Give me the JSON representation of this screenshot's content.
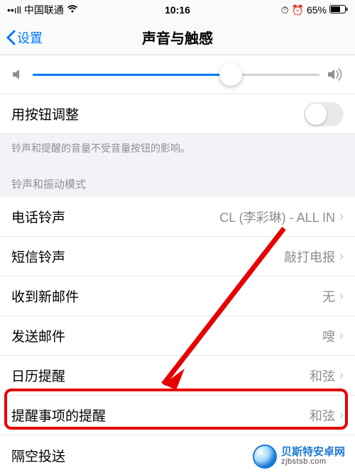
{
  "status_bar": {
    "signal_text": "••ıll",
    "carrier": "中国联通",
    "wifi_glyph": "",
    "time": "10:16",
    "alarm_glyph": "⏱",
    "clock_glyph": "⏰",
    "battery_pct": "65%",
    "battery_glyph": "▮▯"
  },
  "nav": {
    "back_label": "设置",
    "title": "声音与触感"
  },
  "slider": {
    "value_pct": 69
  },
  "button_adjust": {
    "label": "用按钮调整",
    "enabled": false
  },
  "footer_note": "铃声和提醒的音量不受音量按钮的影响。",
  "section_header": "铃声和振动模式",
  "rows": [
    {
      "label": "电话铃声",
      "value": "CL (李彩琳) - ALL IN"
    },
    {
      "label": "短信铃声",
      "value": "敲打电报"
    },
    {
      "label": "收到新邮件",
      "value": "无"
    },
    {
      "label": "发送邮件",
      "value": "嗖"
    },
    {
      "label": "日历提醒",
      "value": "和弦"
    },
    {
      "label": "提醒事项的提醒",
      "value": "和弦"
    },
    {
      "label": "隔空投送",
      "value": ""
    }
  ],
  "chevron": "›",
  "highlight_target_index": 5,
  "watermark": {
    "line1": "贝斯特安卓网",
    "line2": "zjbstsb.com"
  }
}
